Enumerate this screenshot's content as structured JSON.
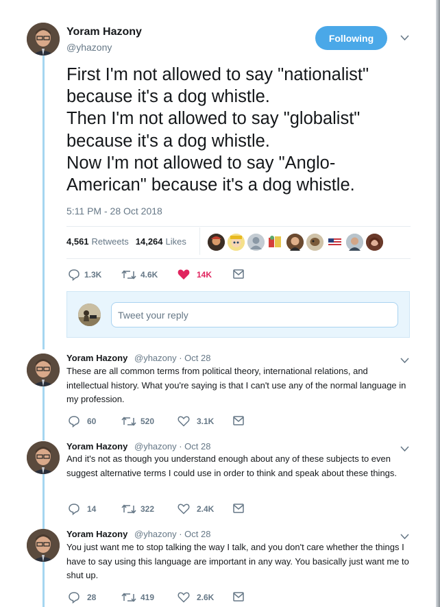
{
  "main_tweet": {
    "author_name": "Yoram Hazony",
    "author_handle": "@yhazony",
    "follow_label": "Following",
    "text": "First I'm not allowed to say \"nationalist\"\nbecause it's a dog whistle.\nThen I'm not allowed to say \"globalist\"\nbecause it's a dog whistle.\nNow I'm not allowed to say \"Anglo-\nAmerican\" because it's a dog whistle.",
    "timestamp": "5:11 PM - 28 Oct 2018",
    "retweets_count": "4,561",
    "retweets_label": "Retweets",
    "likes_count": "14,264",
    "likes_label": "Likes",
    "actions": {
      "replies": "1.3K",
      "retweets": "4.6K",
      "likes": "14K"
    }
  },
  "reply_composer": {
    "placeholder": "Tweet your reply"
  },
  "replies": [
    {
      "name": "Yoram Hazony",
      "meta": "@yhazony · Oct 28",
      "text": "These are all common terms from political theory, international relations, and intellectual history. What you're saying is that I can't use any of the normal language in my profession.",
      "replies": "60",
      "retweets": "520",
      "likes": "3.1K"
    },
    {
      "name": "Yoram Hazony",
      "meta": "@yhazony · Oct 28",
      "text": "And it's not as though you understand enough about any of these subjects to even suggest alternative terms I could use in order to think and speak about these things.",
      "replies": "14",
      "retweets": "322",
      "likes": "2.4K"
    },
    {
      "name": "Yoram Hazony",
      "meta": "@yhazony · Oct 28",
      "text": "You just want me to stop talking the way I talk, and you don't care whether the things I have to say using this language are important in any way. You basically just want me to shut up.",
      "replies": "28",
      "retweets": "419",
      "likes": "2.6K"
    }
  ],
  "colors": {
    "accent": "#4aa8e8",
    "like_red": "#e0245e",
    "thread_line": "#a5d6f0",
    "muted": "#657786"
  }
}
